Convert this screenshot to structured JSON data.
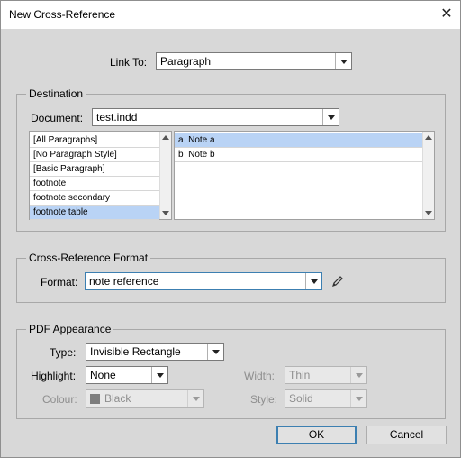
{
  "window": {
    "title": "New Cross-Reference",
    "close_glyph": "✕"
  },
  "link_to": {
    "label": "Link To:",
    "value": "Paragraph"
  },
  "destination": {
    "heading": "Destination",
    "document_label": "Document:",
    "document_value": "test.indd",
    "styles": [
      "[All Paragraphs]",
      "[No Paragraph Style]",
      "[Basic Paragraph]",
      "footnote",
      "footnote secondary",
      "footnote table"
    ],
    "selected_style_index": 5,
    "paragraphs": [
      {
        "marker": "a",
        "text": "Note a"
      },
      {
        "marker": "b",
        "text": "Note b"
      }
    ],
    "selected_paragraph_index": 0
  },
  "xref_format": {
    "heading": "Cross-Reference Format",
    "format_label": "Format:",
    "format_value": "note reference",
    "edit_icon": "pencil-icon"
  },
  "pdf": {
    "heading": "PDF Appearance",
    "type_label": "Type:",
    "type_value": "Invisible Rectangle",
    "highlight_label": "Highlight:",
    "highlight_value": "None",
    "width_label": "Width:",
    "width_value": "Thin",
    "colour_label": "Colour:",
    "colour_value": "Black",
    "colour_swatch": "#7d7d7d",
    "style_label": "Style:",
    "style_value": "Solid"
  },
  "buttons": {
    "ok": "OK",
    "cancel": "Cancel"
  }
}
